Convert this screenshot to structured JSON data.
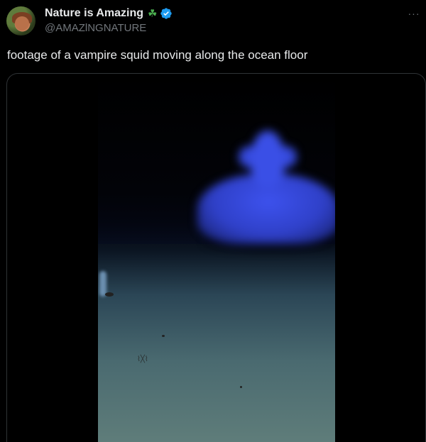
{
  "author": {
    "display_name": "Nature is Amazing",
    "emoji_icon": "shamrock-icon",
    "verified": true,
    "handle": "@AMAZlNGNATURE"
  },
  "more_label": "···",
  "tweet": {
    "text": "footage of a vampire squid moving along the ocean floor"
  },
  "media": {
    "type": "video",
    "accent_color": "#3a4fe6"
  },
  "colors": {
    "background": "#000000",
    "text": "#e7e9ea",
    "secondary": "#71767b",
    "verified": "#1d9bf0",
    "border": "#2f3336"
  }
}
